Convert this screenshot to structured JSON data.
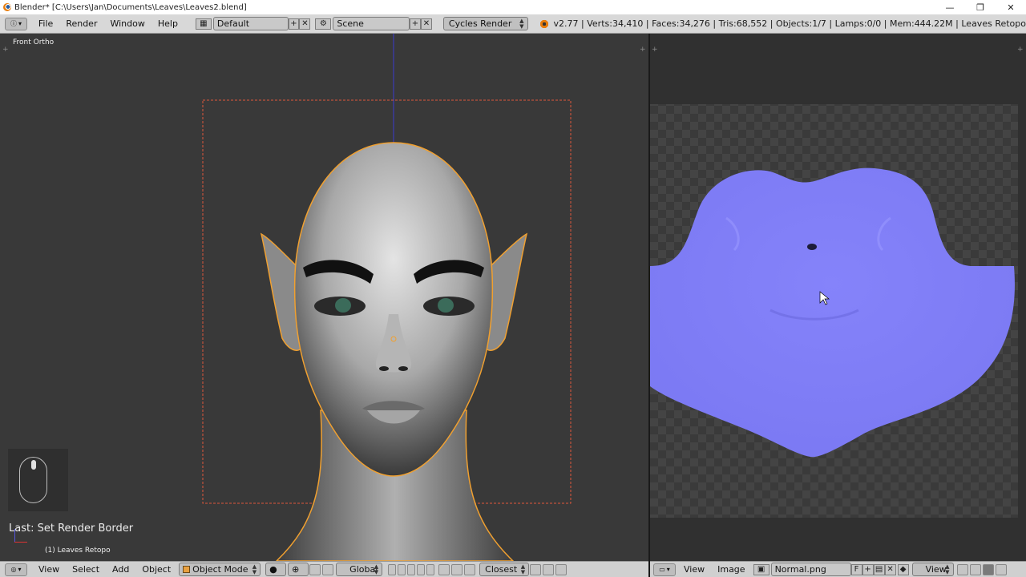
{
  "window": {
    "title": "Blender* [C:\\Users\\Jan\\Documents\\Leaves\\Leaves2.blend]",
    "minimize": "—",
    "restore": "❐",
    "close": "✕"
  },
  "menu": [
    "File",
    "Render",
    "Window",
    "Help"
  ],
  "screen_layout": "Default",
  "scene": "Scene",
  "render_engine": "Cycles Render",
  "stats": "v2.77 | Verts:34,410 | Faces:34,276 | Tris:68,552 | Objects:1/7 | Lamps:0/0 | Mem:444.22M | Leaves Retopo",
  "viewport": {
    "view_name": "Front Ortho",
    "last_operator": "Last: Set Render Border",
    "active_object": "(1) Leaves Retopo"
  },
  "viewport_header": {
    "menus": [
      "View",
      "Select",
      "Add",
      "Object"
    ],
    "mode": "Object Mode",
    "orientation": "Global",
    "snap_target": "Closest"
  },
  "image_header": {
    "menus": [
      "View",
      "Image"
    ],
    "image_name": "Normal.png",
    "fake_user": "F",
    "view_mode": "View"
  },
  "colors": {
    "selection_outline": "#f0a030",
    "render_border": "#e0583a",
    "normal_map": "#7d7cf6",
    "viewport_bg": "#393939"
  }
}
